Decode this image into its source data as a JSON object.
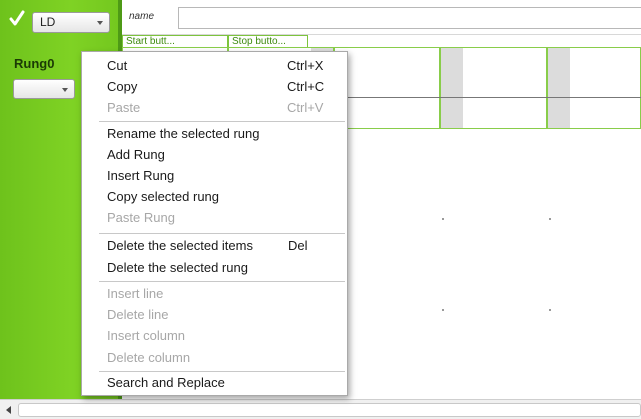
{
  "toolbar": {
    "enabled_checked": true,
    "language_value": "LD",
    "name_label": "name",
    "name_value": ""
  },
  "rung": {
    "label": "Rung0",
    "select_value": ""
  },
  "variables": [
    {
      "label": "Start butt..."
    },
    {
      "label": "Stop butto..."
    }
  ],
  "context_menu": {
    "groups": [
      [
        {
          "label": "Cut",
          "shortcut": "Ctrl+X",
          "enabled": true
        },
        {
          "label": "Copy",
          "shortcut": "Ctrl+C",
          "enabled": true
        },
        {
          "label": "Paste",
          "shortcut": "Ctrl+V",
          "enabled": false
        }
      ],
      [
        {
          "label": "Rename the selected rung",
          "enabled": true
        },
        {
          "label": "Add Rung",
          "enabled": true
        },
        {
          "label": "Insert Rung",
          "enabled": true
        },
        {
          "label": "Copy selected rung",
          "enabled": true
        },
        {
          "label": "Paste Rung",
          "enabled": false
        }
      ],
      [
        {
          "label": "Delete the selected items",
          "shortcut": "Del",
          "enabled": true
        },
        {
          "label": "Delete the selected rung",
          "enabled": true
        }
      ],
      [
        {
          "label": "Insert line",
          "enabled": false
        },
        {
          "label": "Delete line",
          "enabled": false
        },
        {
          "label": "Insert column",
          "enabled": false
        },
        {
          "label": "Delete column",
          "enabled": false
        }
      ],
      [
        {
          "label": "Search and Replace",
          "enabled": true
        }
      ]
    ]
  },
  "colors": {
    "panel_green": "#7fd224",
    "cell_border": "#89cd4a",
    "disabled_text": "#a7a7a7"
  },
  "icons": {
    "enabled": "check-icon",
    "dropdown": "chevron-down-icon",
    "scroll_left": "arrow-left-icon"
  }
}
